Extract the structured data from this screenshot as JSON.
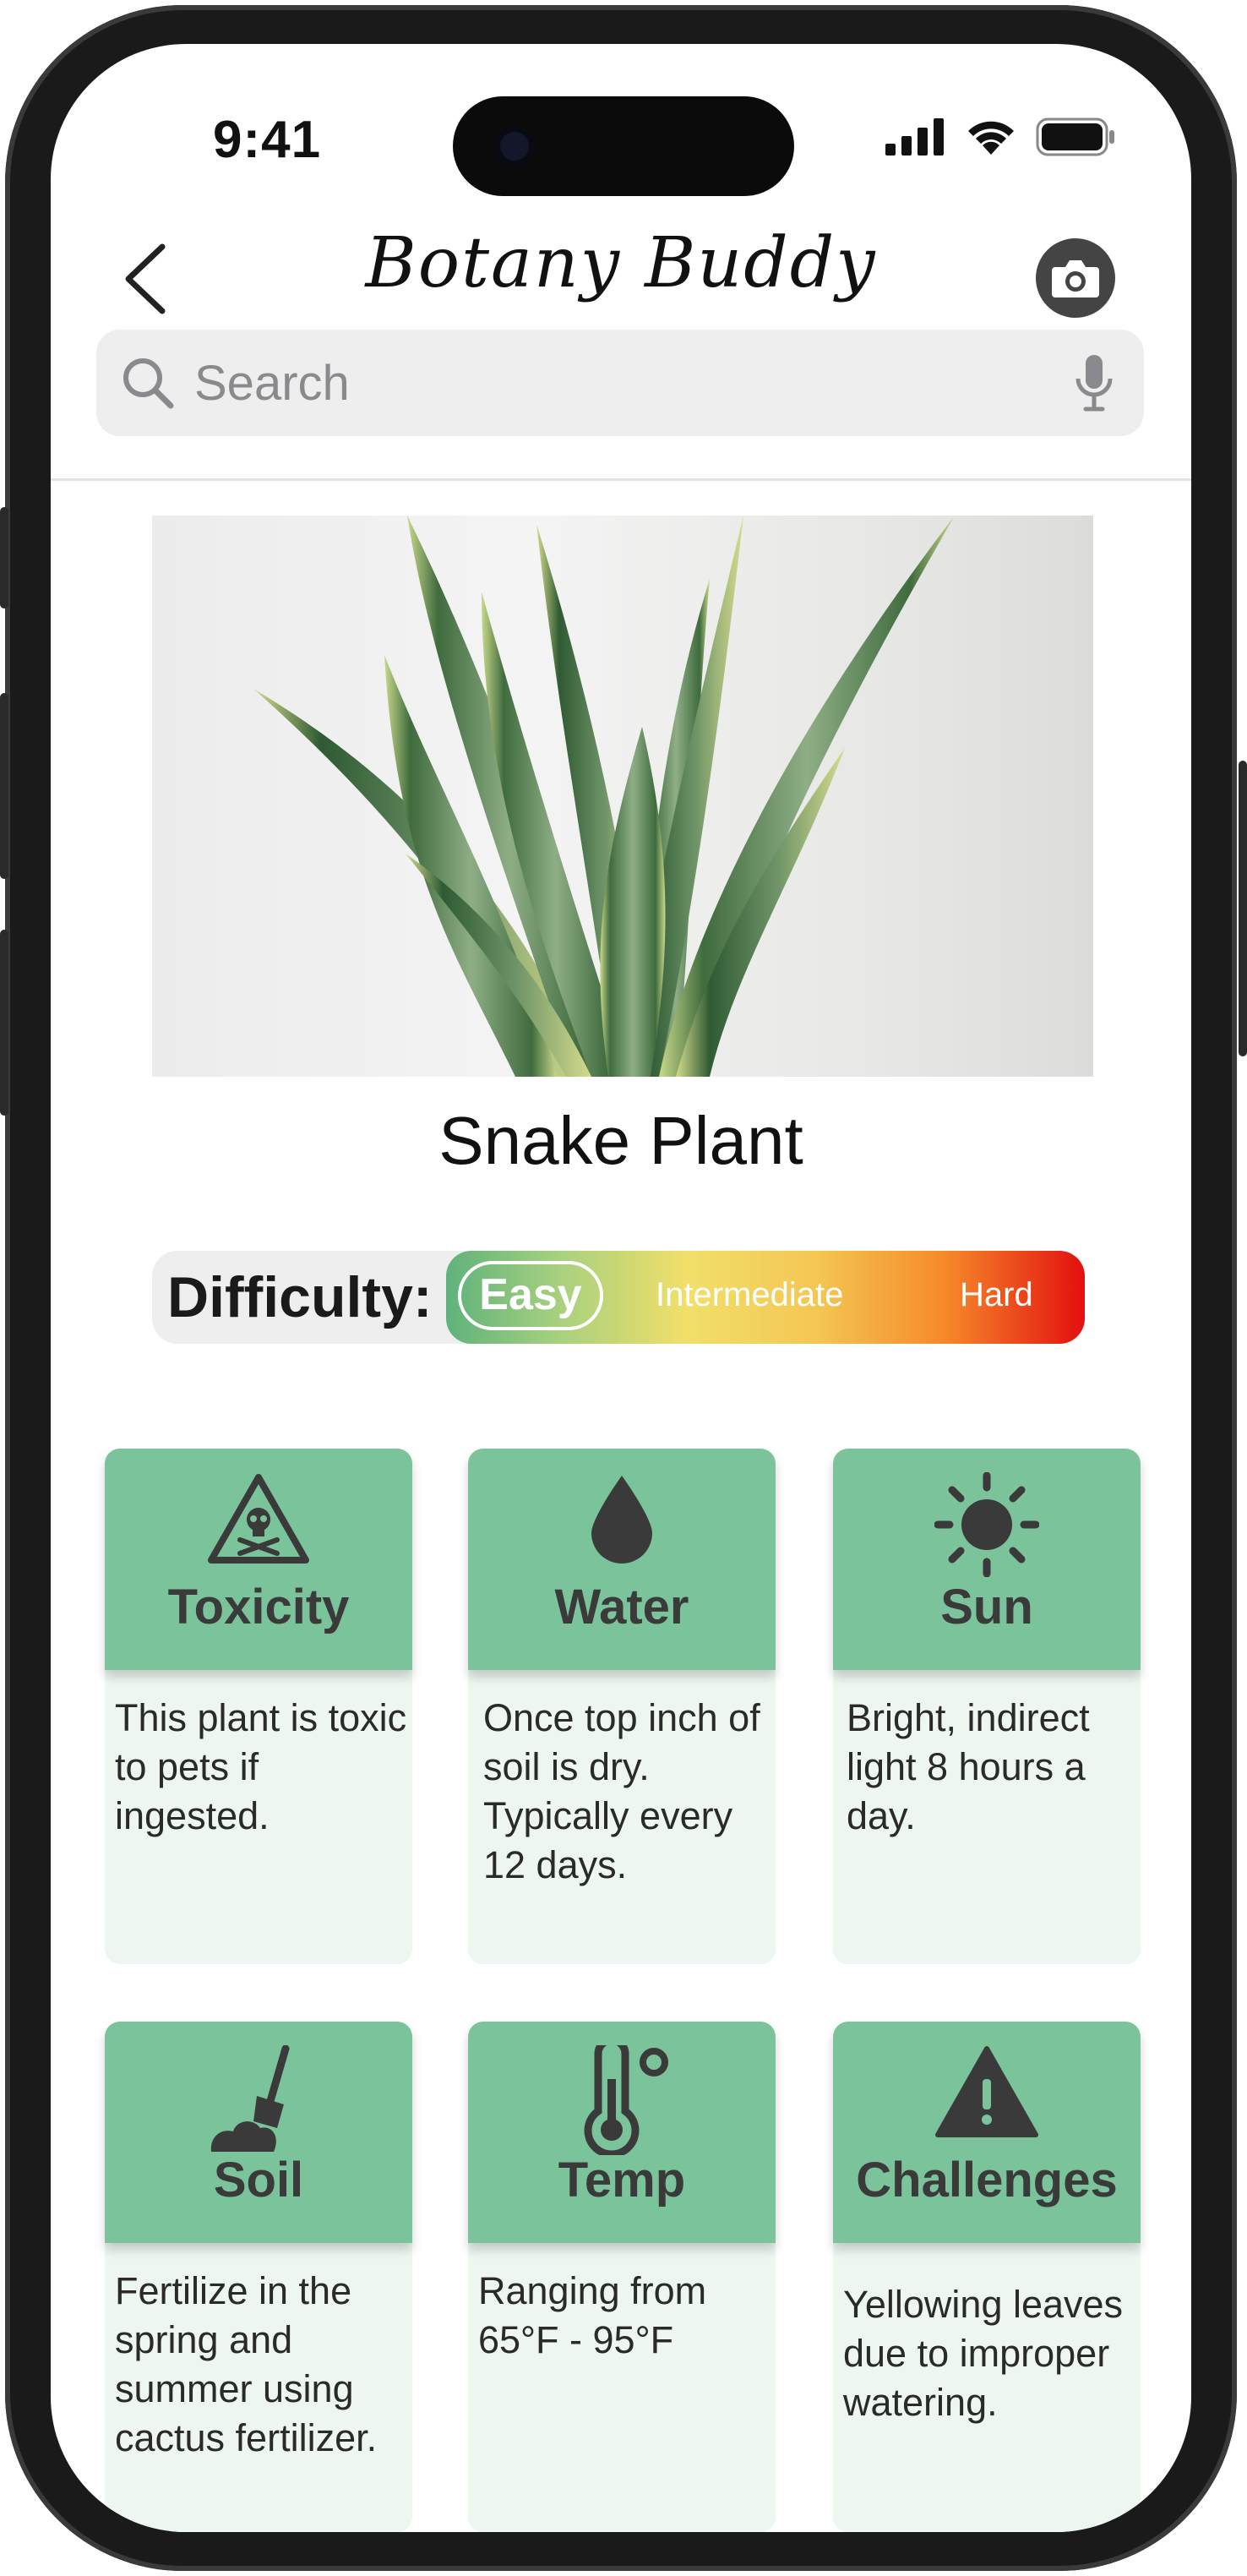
{
  "status": {
    "time": "9:41"
  },
  "header": {
    "title": "Botany Buddy"
  },
  "search": {
    "placeholder": "Search"
  },
  "plant": {
    "name": "Snake Plant"
  },
  "difficulty": {
    "label": "Difficulty:",
    "levels": [
      "Easy",
      "Intermediate",
      "Hard"
    ],
    "selected": "Easy"
  },
  "care_cards": [
    {
      "title": "Toxicity",
      "icon": "skull-warning-icon",
      "text": "This plant is toxic to pets if ingested."
    },
    {
      "title": "Water",
      "icon": "water-drop-icon",
      "text": "Once top inch of soil is dry. Typically every 12 days."
    },
    {
      "title": "Sun",
      "icon": "sun-icon",
      "text": "Bright, indirect light 8 hours a day."
    },
    {
      "title": "Soil",
      "icon": "soil-shovel-icon",
      "text": "Fertilize in the spring and summer using cactus fertilizer."
    },
    {
      "title": "Temp",
      "icon": "thermometer-icon",
      "text": "Ranging from 65°F - 95°F"
    },
    {
      "title": "Challenges",
      "icon": "warning-icon",
      "text": "Yellowing leaves due to improper watering."
    }
  ],
  "colors": {
    "card_header": "#7bc39a",
    "card_body": "#eef6f0",
    "easy": "#5fb27c",
    "hard": "#e30f0f"
  }
}
